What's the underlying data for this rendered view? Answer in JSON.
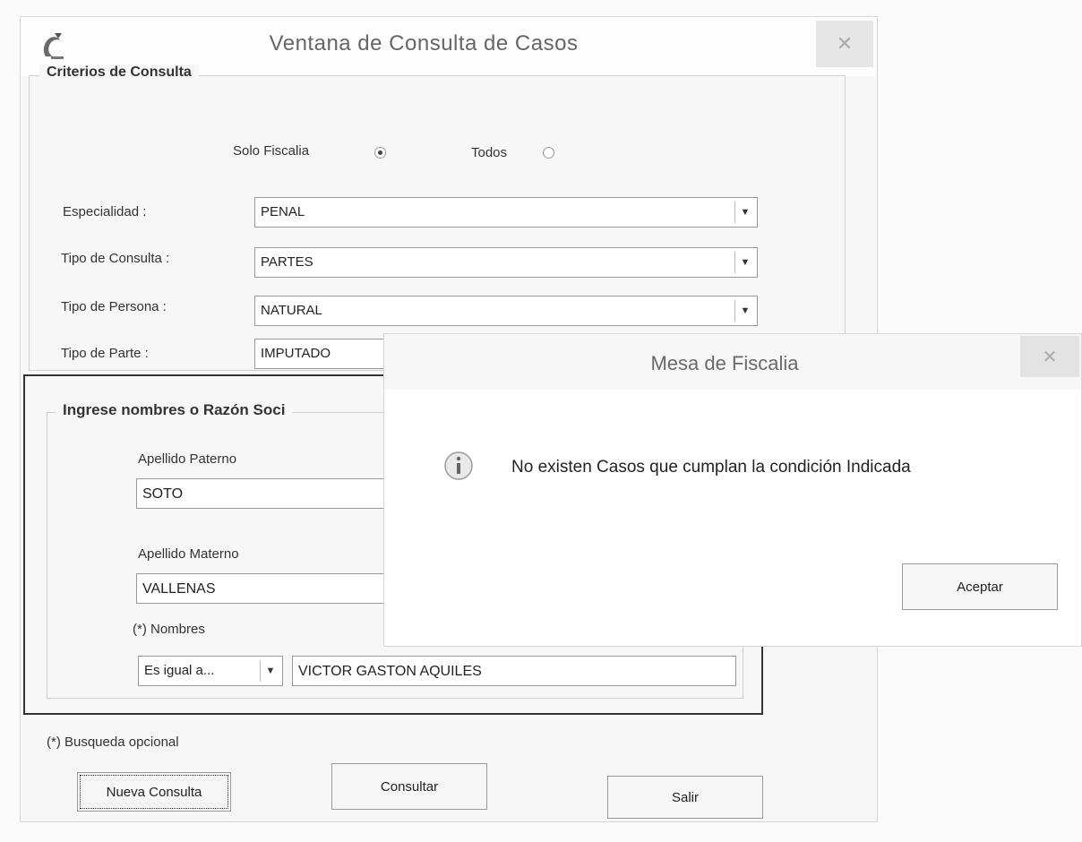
{
  "window": {
    "title": "Ventana de Consulta de Casos",
    "close_glyph": "✕"
  },
  "criteria": {
    "legend": "Criterios de Consulta",
    "radio_solo_fiscalia": {
      "label": "Solo Fiscalia",
      "checked": true
    },
    "radio_todos": {
      "label": "Todos",
      "checked": false
    },
    "fields": [
      {
        "label": "Especialidad :",
        "value": "PENAL"
      },
      {
        "label": "Tipo de Consulta :",
        "value": "PARTES"
      },
      {
        "label": "Tipo de Persona :",
        "value": "NATURAL"
      },
      {
        "label": "Tipo de Parte :",
        "value": "IMPUTADO"
      }
    ]
  },
  "names": {
    "legend": "Ingrese nombres o Razón Soci",
    "apellido_paterno": {
      "label": "Apellido Paterno",
      "value": "SOTO"
    },
    "apellido_materno": {
      "label": "Apellido Materno",
      "value": "VALLENAS"
    },
    "nombres": {
      "label": "(*) Nombres",
      "operator": "Es igual a...",
      "value": "VICTOR GASTON AQUILES"
    }
  },
  "optional_note": "(*) Busqueda opcional",
  "buttons": {
    "new_query": "Nueva Consulta",
    "consult": "Consultar",
    "exit": "Salir"
  },
  "dialog": {
    "title": "Mesa de Fiscalia",
    "message": "No existen Casos que cumplan la condición Indicada",
    "accept": "Aceptar",
    "close_glyph": "✕"
  },
  "icons": {
    "app": "app-icon",
    "info": "info-icon",
    "dropdown": "chevron-down-icon"
  }
}
